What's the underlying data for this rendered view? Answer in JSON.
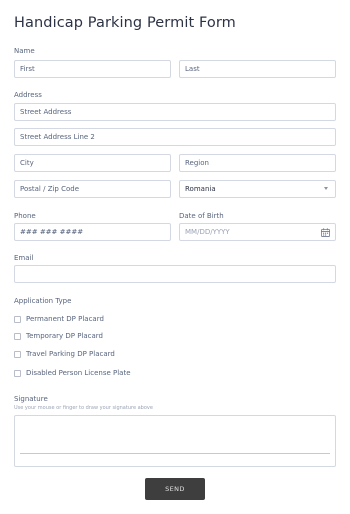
{
  "form": {
    "title": "Handicap Parking Permit Form",
    "name": {
      "label": "Name",
      "first_placeholder": "First",
      "last_placeholder": "Last"
    },
    "address": {
      "label": "Address",
      "street1_placeholder": "Street Address",
      "street2_placeholder": "Street Address Line 2",
      "city_placeholder": "City",
      "region_placeholder": "Region",
      "postal_placeholder": "Postal / Zip Code",
      "country_value": "Romania"
    },
    "phone": {
      "label": "Phone",
      "placeholder": "### ### ####"
    },
    "dob": {
      "label": "Date of Birth",
      "placeholder": "MM/DD/YYYY"
    },
    "email": {
      "label": "Email",
      "value": ""
    },
    "application_type": {
      "label": "Application Type",
      "options": [
        "Permanent DP Placard",
        "Temporary DP Placard",
        "Travel Parking DP Placard",
        "Disabled Person License Plate"
      ]
    },
    "signature": {
      "label": "Signature",
      "hint": "Use your mouse or finger to draw your signature above"
    },
    "send_label": "SEND"
  }
}
